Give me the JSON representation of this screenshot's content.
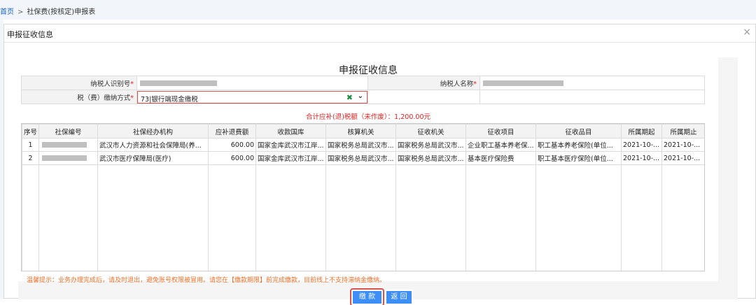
{
  "breadcrumb": {
    "home": "首页",
    "separator": ">",
    "current": "社保费(按核定)申报表"
  },
  "dialog": {
    "title": "申报征收信息",
    "close": "×"
  },
  "form": {
    "title": "申报征收信息",
    "taxpayer_id_label": "纳税人识别号",
    "taxpayer_name_label": "纳税人名称",
    "payment_method_label": "税（费）缴纳方式",
    "required_mark": "*",
    "payment_method_value": "73|银行端现金缴税"
  },
  "total_text": "合计应补(退)税额（未作废）：1,200.00元",
  "grid": {
    "headers": [
      "序号",
      "社保编号",
      "社保经办机构",
      "应补退费额",
      "收款国库",
      "核算机关",
      "征收机关",
      "征收项目",
      "征收品目",
      "所属期起",
      "所属期止"
    ],
    "rows": [
      {
        "no": "1",
        "agency": "武汉市人力资源和社会保障局(养...",
        "amount": "600.00",
        "treasury": "国家金库武汉市江岸...",
        "accounting": "国家税务总局武汉市...",
        "collector": "国家税务总局武汉市...",
        "item": "企业职工基本养老保...",
        "subitem": "职工基本养老保险(单位...",
        "start": "2021-10-...",
        "end": "2021-10-..."
      },
      {
        "no": "2",
        "agency": "武汉市医疗保障局(医疗)",
        "amount": "600.00",
        "treasury": "国家金库武汉市江岸...",
        "accounting": "国家税务总局武汉市...",
        "collector": "国家税务总局武汉市...",
        "item": "基本医疗保险费",
        "subitem": "职工基本医疗保险(单位...",
        "start": "2021-10-...",
        "end": "2021-10-..."
      }
    ]
  },
  "hint": "温馨提示：业务办理完成后，请及时退出，避免账号权限被冒用。请您在【缴款期限】前完成缴款，目前线上不支持滞纳金缴纳。",
  "buttons": {
    "pay": "缴 款",
    "back": "返 回"
  },
  "colors": {
    "accent": "#3e8ef7",
    "required": "#e02020",
    "hint": "#e8702a",
    "highlight_border": "#d9534f"
  }
}
